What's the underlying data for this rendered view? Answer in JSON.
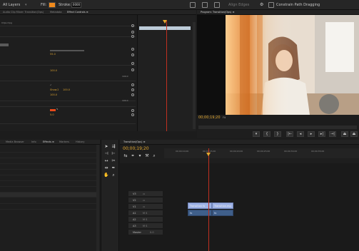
{
  "toolbar": {
    "layers_select": "All Layers",
    "fill_label": "Fill:",
    "fill_color": "#f08a1c",
    "stroke_label": "Stroke:",
    "stroke_value": "0000",
    "align_label": "Align Edges",
    "constrain_label": "Constrain Path Dragging"
  },
  "effect_controls": {
    "tabs": [
      "Audio Clip Mixer: Transition(Ops)",
      "Metadata",
      "Effect Controls ≡"
    ],
    "active_tab": 2,
    "clip_name": "Clips.mpg",
    "values": {
      "v1": "55.0",
      "v2": "100.0",
      "v3a": "100.0",
      "v3b": "Show.2",
      "v3c": "100.0",
      "v4": "100.0",
      "v5": "100.0",
      "v6": "100.0",
      "v7": "5.0"
    },
    "colors": {
      "accent": "#e3a82f",
      "swatch": "#e84a1a"
    }
  },
  "program_monitor": {
    "tab": "Program: Transition(Ops) ≡",
    "timecode": "00;00;19;20",
    "fit": "Fit"
  },
  "project_panel": {
    "tabs": [
      "Media Browser",
      "Info",
      "Effects ≡",
      "Markers",
      "History"
    ],
    "active_tab": 2
  },
  "timeline": {
    "tab": "Transition(Ops) ≡",
    "timecode": "00;00;19;20",
    "ruler_labels": [
      "00;00;10;00",
      "00;00;15;00",
      "00;00;20;00",
      "00;00;25;00",
      "00;00;30;00",
      "00;00;35;00"
    ],
    "tracks": [
      {
        "label": "V3"
      },
      {
        "label": "V2"
      },
      {
        "label": "V1"
      },
      {
        "label": "A1"
      },
      {
        "label": "A2"
      },
      {
        "label": "A3"
      },
      {
        "label": "Master"
      }
    ],
    "master_value": "0.0",
    "clips": {
      "v1_a": "Transition fx",
      "v1_b": "Transition.mp",
      "a1_a": "fx",
      "a1_b": "fx"
    }
  }
}
